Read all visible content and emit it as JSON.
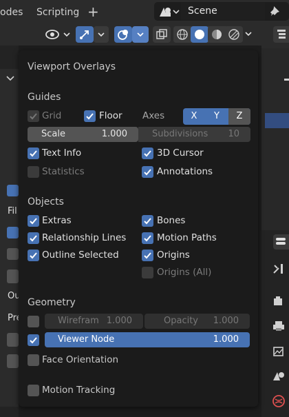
{
  "topbar": {
    "tab_partial": "odes",
    "tab_scripting": "Scripting",
    "add_tab": "+",
    "scene_name": "Scene"
  },
  "popover": {
    "title": "Viewport Overlays",
    "guides": {
      "heading": "Guides",
      "grid": "Grid",
      "floor": "Floor",
      "axes_label": "Axes",
      "axes": [
        "X",
        "Y",
        "Z"
      ],
      "scale_label": "Scale",
      "scale_value": "1.000",
      "subdiv_label": "Subdivisions",
      "subdiv_value": "10",
      "text_info": "Text Info",
      "cursor_3d": "3D Cursor",
      "statistics": "Statistics",
      "annotations": "Annotations"
    },
    "objects": {
      "heading": "Objects",
      "extras": "Extras",
      "bones": "Bones",
      "relationship_lines": "Relationship Lines",
      "motion_paths": "Motion Paths",
      "outline_selected": "Outline Selected",
      "origins": "Origins",
      "origins_all": "Origins (All)"
    },
    "geometry": {
      "heading": "Geometry",
      "wireframe_label": "Wirefram",
      "wireframe_value": "1.000",
      "opacity_label": "Opacity",
      "opacity_value": "1.000",
      "viewer_node_label": "Viewer Node",
      "viewer_node_value": "1.000",
      "face_orientation": "Face Orientation"
    },
    "motion_tracking": "Motion Tracking"
  },
  "left_partial": {
    "fil": "Fil",
    "ou": "Ou",
    "pre": "Pre"
  },
  "colors": {
    "accent": "#4772b3",
    "panel": "#1b1b1b",
    "header": "#2b2b2b"
  }
}
